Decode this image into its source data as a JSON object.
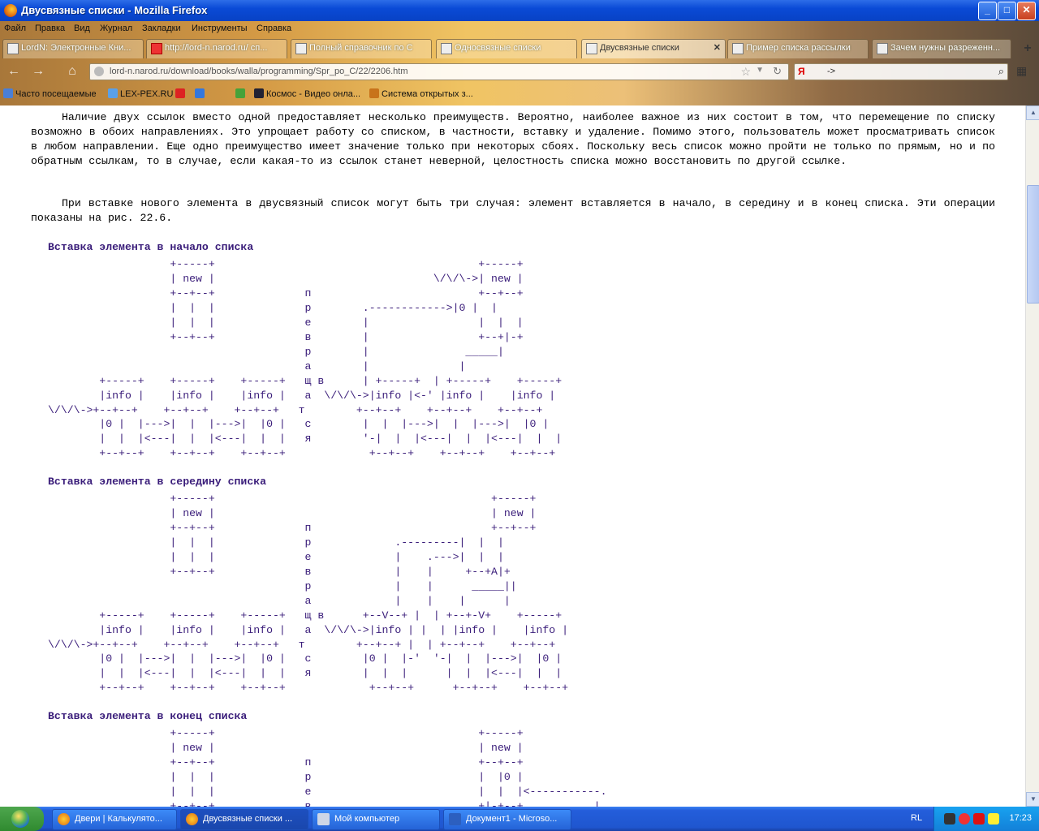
{
  "window": {
    "title": "Двусвязные списки - Mozilla Firefox",
    "controls": {
      "minimize": "_",
      "maximize": "□",
      "close": "✕"
    }
  },
  "menu": [
    "Файл",
    "Правка",
    "Вид",
    "Журнал",
    "Закладки",
    "Инструменты",
    "Справка"
  ],
  "tabs": [
    {
      "label": "LordN: Электронные Кни...",
      "icon": "page-icon"
    },
    {
      "label": "http://lord-n.narod.ru/ сп...",
      "icon": "yandex-icon"
    },
    {
      "label": "Полный справочник по С",
      "icon": "page-icon"
    },
    {
      "label": "Односвязные списки",
      "icon": "page-icon"
    },
    {
      "label": "Двусвязные списки",
      "icon": "page-icon",
      "active": true
    },
    {
      "label": "Пример списка рассылки",
      "icon": "page-icon"
    },
    {
      "label": "Зачем нужны разреженн...",
      "icon": "page-icon"
    }
  ],
  "tab_close": "✕",
  "new_tab": "+",
  "nav": {
    "url": "lord-n.narod.ru/download/books/walla/programming/Spr_po_C/22/2206.htm",
    "search_engine": "Я",
    "search_value": "->",
    "back": "←",
    "forward": "→",
    "home": "⌂"
  },
  "bookmarks": [
    {
      "label": "Часто посещаемые",
      "icon": "star-icon",
      "color": "#4a7fd6"
    },
    {
      "label": "LEX-PEX.RU",
      "icon": "person-icon",
      "color": "#5aa0e8"
    },
    {
      "label": "",
      "icon": "mail-icon",
      "color": "#d22"
    },
    {
      "label": "",
      "icon": "at-icon",
      "color": "#3377dd"
    },
    {
      "label": "",
      "icon": "puzzle-icon",
      "color": "#46a23a"
    },
    {
      "label": "Космос - Видео онла...",
      "icon": "space-icon",
      "color": "#223"
    },
    {
      "label": "Система открытых з...",
      "icon": "books-icon",
      "color": "#c8731b"
    }
  ],
  "content": {
    "para1": "Наличие двух ссылок вместо одной предоставляет несколько преимуществ. Вероятно, наиболее важное из них состоит в том, что перемещение по списку возможно в обоих направлениях. Это упрощает работу со списком, в частности, вставку и удаление. Помимо этого, пользователь может просматривать список в любом направлении. Еще одно преимущество имеет значение только при некоторых сбоях. Поскольку весь список можно пройти не только по прямым, но и по обратным ссылкам, то в случае, если какая-то из ссылок станет неверной, целостность списка можно восстановить по другой ссылке.",
    "para2": "При вставке нового элемента в двусвязный список могут быть три случая: элемент вставляется в начало, в середину и в конец списка. Эти операции показаны на рис. 22.6.",
    "sections": [
      {
        "heading": "Вставка элемента в начало списка",
        "diagram": "                   +-----+                                         +-----+\n                   | new |                                  \\/\\/\\->| new |\n                   +--+--+              п                          +--+--+\n                   |  |  |              р        .------------>|0 |  |\n                   |  |  |              е        |                 |  |  |\n                   +--+--+              в        |                 +--+|-+\n                                        р        |               _____|\n                                        а        |              |\n        +-----+    +-----+    +-----+   щ в      | +-----+  | +-----+    +-----+\n        |info |    |info |    |info |   а  \\/\\/\\->|info |<-' |info |    |info |\n\\/\\/\\->+--+--+    +--+--+    +--+--+   т        +--+--+    +--+--+    +--+--+\n        |0 |  |--->|  |  |--->|  |0 |   с        |  |  |--->|  |  |--->|  |0 |\n        |  |  |<---|  |  |<---|  |  |   я        '-|  |  |<---|  |  |<---|  |  |\n        +--+--+    +--+--+    +--+--+             +--+--+    +--+--+    +--+--+"
      },
      {
        "heading": "Вставка элемента в середину списка",
        "diagram": "                   +-----+                                           +-----+\n                   | new |                                           | new |\n                   +--+--+              п                            +--+--+\n                   |  |  |              р             .---------|  |  |\n                   |  |  |              е             |    .--->|  |  |\n                   +--+--+              в             |    |     +--+A|+\n                                        р             |    |      _____||\n                                        а             |    |    |      |\n        +-----+    +-----+    +-----+   щ в      +--V--+ |  | +--+-V+    +-----+\n        |info |    |info |    |info |   а  \\/\\/\\->|info | |  | |info |    |info |\n\\/\\/\\->+--+--+    +--+--+    +--+--+   т        +--+--+ |  | +--+--+    +--+--+\n        |0 |  |--->|  |  |--->|  |0 |   с        |0 |  |-'  '-|  |  |--->|  |0 |\n        |  |  |<---|  |  |<---|  |  |   я        |  |  |      |  |  |<---|  |  |\n        +--+--+    +--+--+    +--+--+             +--+--+      +--+--+    +--+--+"
      },
      {
        "heading": "Вставка элемента в конец списка",
        "diagram": "                   +-----+                                         +-----+\n                   | new |                                         | new |\n                   +--+--+              п                          +--+--+\n                   |  |  |              р                          |  |0 |\n                   |  |  |              е                          |  |  |<-----------.\n                   +--+--+              в                          +|-+--+           |"
      }
    ]
  },
  "taskbar": {
    "tasks": [
      {
        "label": "Двери | Калькулято...",
        "icon": "firefox-icon"
      },
      {
        "label": "Двусвязные списки ...",
        "icon": "firefox-icon",
        "active": true
      },
      {
        "label": "Мой компьютер",
        "icon": "computer-icon"
      },
      {
        "label": "Документ1 - Microso...",
        "icon": "word-icon"
      }
    ],
    "lang": "RL",
    "clock": "17:23"
  }
}
